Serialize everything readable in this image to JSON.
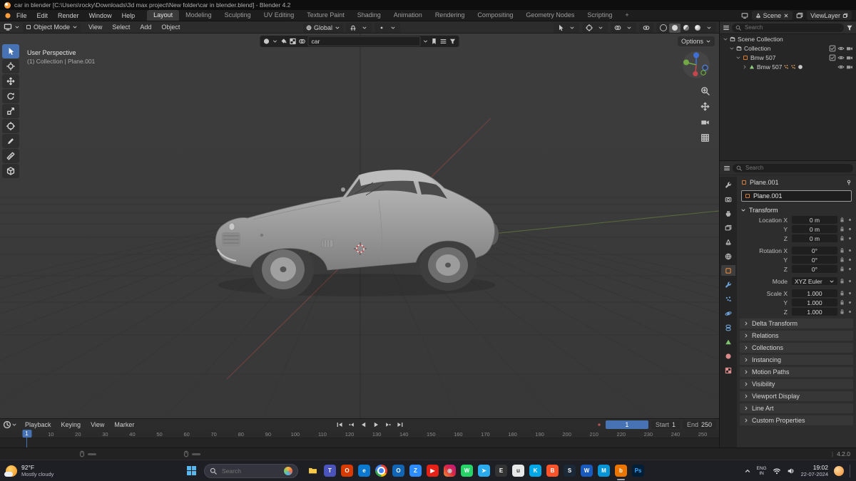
{
  "colors": {
    "accent": "#4772b3",
    "object_orange": "#e8883a",
    "axis_green": "#5d6e3c",
    "axis_red": "#7a4444"
  },
  "window": {
    "title": "car in blender [C:\\Users\\rocky\\Downloads\\3d max project\\New folder\\car in blender.blend] - Blender 4.2"
  },
  "topbar": {
    "menus": [
      "File",
      "Edit",
      "Render",
      "Window",
      "Help"
    ],
    "workspaces": [
      "Layout",
      "Modeling",
      "Sculpting",
      "UV Editing",
      "Texture Paint",
      "Shading",
      "Animation",
      "Rendering",
      "Compositing",
      "Geometry Nodes",
      "Scripting"
    ],
    "active_workspace": "Layout",
    "add_workspace_label": "+",
    "scene_label": "Scene",
    "viewlayer_label": "ViewLayer"
  },
  "viewport_header": {
    "mode": "Object Mode",
    "menus": [
      "View",
      "Select",
      "Add",
      "Object"
    ],
    "orientation": "Global",
    "options_label": "Options"
  },
  "tool_settings": {
    "name_value": "car"
  },
  "viewport": {
    "perspective_label": "User Perspective",
    "context_label": "(1) Collection | Plane.001",
    "tools": [
      {
        "name": "select-box",
        "icon": "pointer"
      },
      {
        "name": "cursor",
        "icon": "cursor3d"
      },
      {
        "name": "move",
        "icon": "move"
      },
      {
        "name": "rotate",
        "icon": "rotate"
      },
      {
        "name": "scale",
        "icon": "scale"
      },
      {
        "name": "transform",
        "icon": "transform"
      },
      {
        "name": "annotate",
        "icon": "pencil"
      },
      {
        "name": "measure",
        "icon": "ruler"
      },
      {
        "name": "add-cube",
        "icon": "cube"
      }
    ]
  },
  "outliner": {
    "search_placeholder": "Search",
    "rows": [
      {
        "label": "Scene Collection",
        "depth": 0,
        "icon": "scene-collection",
        "expander": "down",
        "extras": [],
        "controls": []
      },
      {
        "label": "Collection",
        "depth": 1,
        "icon": "collection",
        "expander": "down",
        "extras": [],
        "controls": [
          "checkbox",
          "eye",
          "camera"
        ]
      },
      {
        "label": "Bmw 507",
        "depth": 2,
        "icon": "object",
        "expander": "down",
        "extras": [],
        "controls": [
          "checkbox",
          "eye",
          "camera"
        ]
      },
      {
        "label": "Bmw 507",
        "depth": 3,
        "icon": "mesh",
        "expander": "right",
        "extras": [
          "armature",
          "armature",
          "material"
        ],
        "controls": [
          "eye",
          "camera"
        ]
      }
    ]
  },
  "properties": {
    "search_placeholder": "Search",
    "breadcrumb": "Plane.001",
    "name_value": "Plane.001",
    "transform_title": "Transform",
    "tabs": [
      {
        "name": "tool",
        "icon": "wrench",
        "color": "#b4b4b4",
        "active": false
      },
      {
        "name": "render",
        "icon": "camback",
        "color": "#b4b4b4",
        "active": false
      },
      {
        "name": "output",
        "icon": "printer",
        "color": "#b4b4b4",
        "active": false
      },
      {
        "name": "view-layer",
        "icon": "imgstack",
        "color": "#b4b4b4",
        "active": false
      },
      {
        "name": "scene",
        "icon": "cone",
        "color": "#b4b4b4",
        "active": false
      },
      {
        "name": "world",
        "icon": "globe",
        "color": "#b4b4b4",
        "active": false
      },
      {
        "name": "object",
        "icon": "squareo",
        "color": "#e8883a",
        "active": true
      },
      {
        "name": "modifiers",
        "icon": "wrench",
        "color": "#6b9fd4",
        "active": false
      },
      {
        "name": "particles",
        "icon": "particles",
        "color": "#6b9fd4",
        "active": false
      },
      {
        "name": "physics",
        "icon": "physics",
        "color": "#6b9fd4",
        "active": false
      },
      {
        "name": "constraints",
        "icon": "constraint",
        "color": "#6b9fd4",
        "active": false
      },
      {
        "name": "data",
        "icon": "tri",
        "color": "#7ec16f",
        "active": false
      },
      {
        "name": "material",
        "icon": "sphere",
        "color": "#d98a8a",
        "active": false
      },
      {
        "name": "texture",
        "icon": "checker",
        "color": "#d98a8a",
        "active": false
      }
    ],
    "transform_rows": [
      {
        "label": "Location X",
        "value": "0 m",
        "kind": "number",
        "gap": false
      },
      {
        "label": "Y",
        "value": "0 m",
        "kind": "number",
        "gap": false
      },
      {
        "label": "Z",
        "value": "0 m",
        "kind": "number",
        "gap": false
      },
      {
        "label": "Rotation X",
        "value": "0°",
        "kind": "number",
        "gap": true
      },
      {
        "label": "Y",
        "value": "0°",
        "kind": "number",
        "gap": false
      },
      {
        "label": "Z",
        "value": "0°",
        "kind": "number",
        "gap": false
      },
      {
        "label": "Mode",
        "value": "XYZ Euler",
        "kind": "select",
        "gap": true
      },
      {
        "label": "Scale X",
        "value": "1.000",
        "kind": "number",
        "gap": true
      },
      {
        "label": "Y",
        "value": "1.000",
        "kind": "number",
        "gap": false
      },
      {
        "label": "Z",
        "value": "1.000",
        "kind": "number",
        "gap": false
      }
    ],
    "sections": [
      "Delta Transform",
      "Relations",
      "Collections",
      "Instancing",
      "Motion Paths",
      "Visibility",
      "Viewport Display",
      "Line Art",
      "Custom Properties"
    ]
  },
  "timeline": {
    "menus": [
      "Playback",
      "Keying",
      "View",
      "Marker"
    ],
    "current_frame": "1",
    "start_label": "Start",
    "start_value": "1",
    "end_label": "End",
    "end_value": "250",
    "ticks": [
      1,
      10,
      20,
      30,
      40,
      50,
      60,
      70,
      80,
      90,
      100,
      110,
      120,
      130,
      140,
      150,
      160,
      170,
      180,
      190,
      200,
      210,
      220,
      230,
      240,
      250
    ]
  },
  "statusbar": {
    "version": "4.2.0"
  },
  "taskbar": {
    "weather_temp": "92°F",
    "weather_desc": "Mostly cloudy",
    "search_placeholder": "Search",
    "lang_line1": "ENG",
    "lang_line2": "IN",
    "time": "19:02",
    "date": "22-07-2024",
    "apps": [
      {
        "name": "file-explorer",
        "glyph": "",
        "bg": "folder",
        "fg": "#f6c94a",
        "active": false
      },
      {
        "name": "teams",
        "glyph": "T",
        "bg": "#4b53bc",
        "fg": "#ffffff",
        "active": false
      },
      {
        "name": "office",
        "glyph": "O",
        "bg": "#d83b01",
        "fg": "#ffffff",
        "active": false
      },
      {
        "name": "edge",
        "glyph": "e",
        "bg": "#0b79d0",
        "fg": "#ffffff",
        "active": false
      },
      {
        "name": "chrome",
        "glyph": "",
        "bg": "chrome",
        "fg": "#ffffff",
        "active": false
      },
      {
        "name": "outlook",
        "glyph": "O",
        "bg": "#1066b5",
        "fg": "#ffffff",
        "active": false
      },
      {
        "name": "zoom",
        "glyph": "Z",
        "bg": "#2d8cff",
        "fg": "#ffffff",
        "active": false
      },
      {
        "name": "youtube",
        "glyph": "▶",
        "bg": "#e62117",
        "fg": "#ffffff",
        "active": false
      },
      {
        "name": "instagram",
        "glyph": "◉",
        "bg": "insta",
        "fg": "#ffffff",
        "active": false
      },
      {
        "name": "whatsapp",
        "glyph": "W",
        "bg": "#25d366",
        "fg": "#ffffff",
        "active": false
      },
      {
        "name": "telegram",
        "glyph": "➤",
        "bg": "#2aabee",
        "fg": "#ffffff",
        "active": false
      },
      {
        "name": "epic-games",
        "glyph": "E",
        "bg": "#333333",
        "fg": "#ffffff",
        "active": false
      },
      {
        "name": "ubisoft",
        "glyph": "u",
        "bg": "#e8e8e8",
        "fg": "#333333",
        "active": false
      },
      {
        "name": "kinemaster",
        "glyph": "K",
        "bg": "#00a8e8",
        "fg": "#ffffff",
        "active": false
      },
      {
        "name": "brave",
        "glyph": "B",
        "bg": "#fb542b",
        "fg": "#ffffff",
        "active": false
      },
      {
        "name": "steam",
        "glyph": "S",
        "bg": "#1b2838",
        "fg": "#ffffff",
        "active": false
      },
      {
        "name": "word",
        "glyph": "W",
        "bg": "#185abd",
        "fg": "#ffffff",
        "active": false
      },
      {
        "name": "maya",
        "glyph": "M",
        "bg": "#0696d7",
        "fg": "#ffffff",
        "active": false
      },
      {
        "name": "blender",
        "glyph": "b",
        "bg": "#ea7600",
        "fg": "#ffffff",
        "active": true
      },
      {
        "name": "photoshop",
        "glyph": "Ps",
        "bg": "#001e36",
        "fg": "#31a8ff",
        "active": false
      }
    ]
  }
}
